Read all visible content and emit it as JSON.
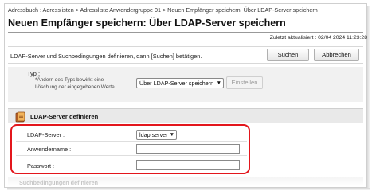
{
  "breadcrumb": "Adressbuch : Adresslisten > Adressliste Anwendergruppe 01 > Neuen Empfänger speichern: Über LDAP-Server speichern",
  "page_title": "Neuen Empfänger speichern: Über LDAP-Server speichern",
  "last_updated": "Zuletzt aktualisiert : 02/04 2024 11:23:28",
  "instruction": "LDAP-Server und Suchbedingungen definieren, dann [Suchen] betätigen.",
  "buttons": {
    "search": "Suchen",
    "cancel": "Abbrechen",
    "settings": "Einstellen"
  },
  "type_section": {
    "label": "Typ :",
    "note": "*Ändern des Typs bewirkt eine Löschung der eingegebenen Werte.",
    "selected": "Über LDAP-Server speichern"
  },
  "ldap_section": {
    "title": "LDAP-Server definieren",
    "server_label": "LDAP-Server :",
    "server_value": "ldap server",
    "username_label": "Anwendername :",
    "username_value": "",
    "password_label": "Passwort :",
    "password_value": ""
  },
  "search_conditions_title": "Suchbedingungen definieren",
  "colors": {
    "highlight": "#e3161c",
    "section_bg": "#f1f1f1",
    "header_bg": "#e9e9e9"
  }
}
